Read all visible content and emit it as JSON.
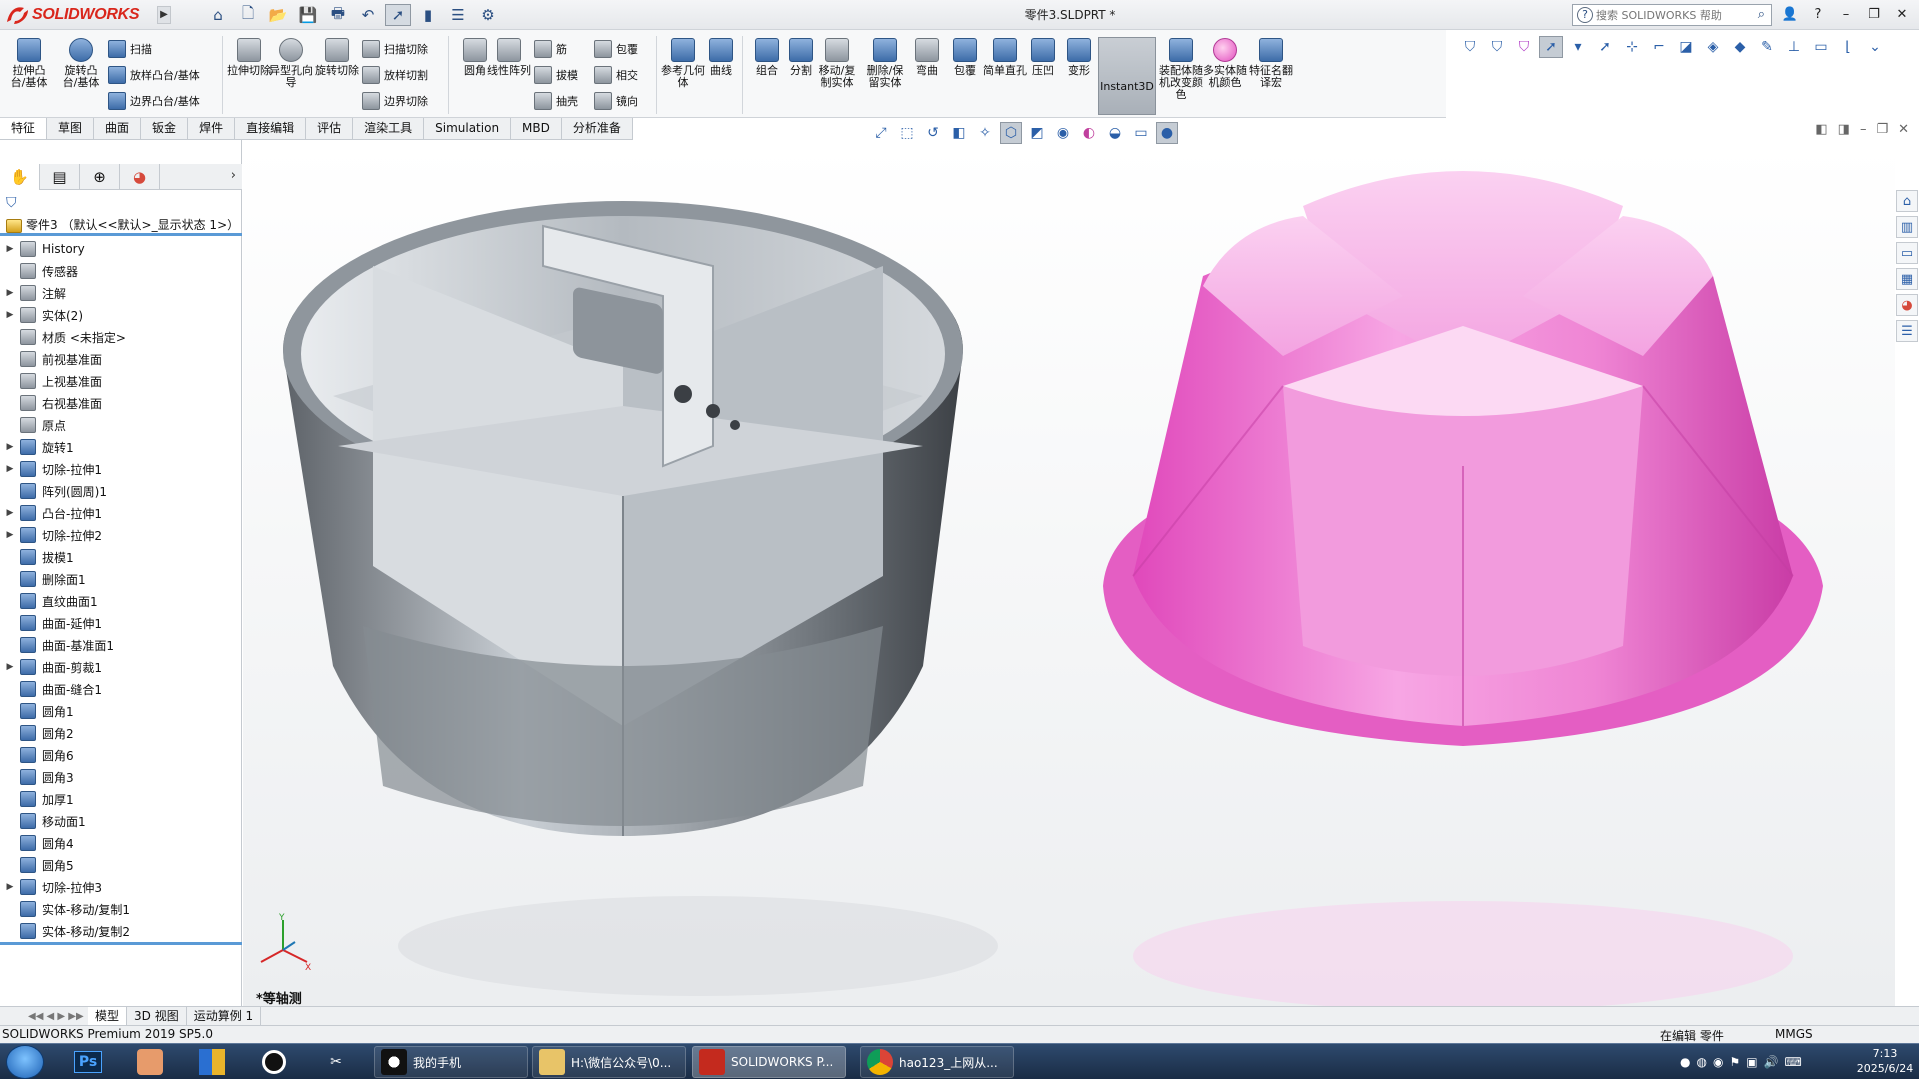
{
  "app": {
    "logo_brand": "SOLIDWORKS",
    "document_title": "零件3.SLDPRT *"
  },
  "search": {
    "placeholder": "搜索 SOLIDWORKS 帮助",
    "icon": "help-icon"
  },
  "quick_access": [
    "home-icon",
    "new-icon",
    "open-icon",
    "save-icon",
    "print-icon",
    "undo-icon",
    "select-icon",
    "traffic-light-icon",
    "options-icon",
    "settings-icon"
  ],
  "commands": {
    "extrude_boss": "拉伸凸台/基体",
    "revolve_boss": "旋转凸台/基体",
    "sweep": "扫描",
    "loft_boss": "放样凸台/基体",
    "boundary_boss": "边界凸台/基体",
    "extrude_cut": "拉伸切除",
    "hole_wizard": "异型孔向导",
    "revolve_cut": "旋转切除",
    "sweep_cut": "扫描切除",
    "loft_cut": "放样切割",
    "boundary_cut": "边界切除",
    "fillet": "圆角",
    "linear_pattern": "线性阵列",
    "rib": "筋",
    "draft": "拔模",
    "shell": "抽壳",
    "wrap": "包覆",
    "intersect": "相交",
    "mirror": "镜向",
    "ref_geometry": "参考几何体",
    "curves": "曲线",
    "combine": "组合",
    "split": "分割",
    "move_copy": "移动/复制实体",
    "delete_keep": "删除/保留实体",
    "flex": "弯曲",
    "wrap2": "包覆",
    "simple_hole": "简单直孔",
    "indent": "压凹",
    "deform": "变形",
    "instant3d": "Instant3D",
    "assembly_color": "装配体随机改变颜色",
    "multibody_color": "多实体随机颜色",
    "feature_translate": "特征名翻译宏"
  },
  "tabs": [
    "特征",
    "草图",
    "曲面",
    "钣金",
    "焊件",
    "直接编辑",
    "评估",
    "渲染工具",
    "Simulation",
    "MBD",
    "分析准备"
  ],
  "feature_tree": {
    "root": "零件3 （默认<<默认>_显示状态 1>）",
    "items": [
      {
        "label": "History",
        "expand": true
      },
      {
        "label": "传感器",
        "expand": false
      },
      {
        "label": "注解",
        "expand": true
      },
      {
        "label": "实体(2)",
        "expand": true
      },
      {
        "label": "材质 <未指定>",
        "expand": false
      },
      {
        "label": "前视基准面",
        "expand": false
      },
      {
        "label": "上视基准面",
        "expand": false
      },
      {
        "label": "右视基准面",
        "expand": false
      },
      {
        "label": "原点",
        "expand": false
      },
      {
        "label": "旋转1",
        "expand": true
      },
      {
        "label": "切除-拉伸1",
        "expand": true
      },
      {
        "label": "阵列(圆周)1",
        "expand": false
      },
      {
        "label": "凸台-拉伸1",
        "expand": true
      },
      {
        "label": "切除-拉伸2",
        "expand": true
      },
      {
        "label": "拔模1",
        "expand": false
      },
      {
        "label": "删除面1",
        "expand": false
      },
      {
        "label": "直纹曲面1",
        "expand": false
      },
      {
        "label": "曲面-延伸1",
        "expand": false
      },
      {
        "label": "曲面-基准面1",
        "expand": false
      },
      {
        "label": "曲面-剪裁1",
        "expand": true
      },
      {
        "label": "曲面-缝合1",
        "expand": false
      },
      {
        "label": "圆角1",
        "expand": false
      },
      {
        "label": "圆角2",
        "expand": false
      },
      {
        "label": "圆角6",
        "expand": false
      },
      {
        "label": "圆角3",
        "expand": false
      },
      {
        "label": "加厚1",
        "expand": false
      },
      {
        "label": "移动面1",
        "expand": false
      },
      {
        "label": "圆角4",
        "expand": false
      },
      {
        "label": "圆角5",
        "expand": false
      },
      {
        "label": "切除-拉伸3",
        "expand": true
      },
      {
        "label": "实体-移动/复制1",
        "expand": false
      },
      {
        "label": "实体-移动/复制2",
        "expand": false
      }
    ]
  },
  "viewport": {
    "view_name": "*等轴测",
    "part_colors": {
      "left": "#9aa3ab",
      "right": "#f48ad8"
    }
  },
  "bottom_tabs": [
    "模型",
    "3D 视图",
    "运动算例 1"
  ],
  "status": {
    "version": "SOLIDWORKS Premium 2019 SP5.0",
    "mode": "在编辑 零件",
    "units": "MMGS"
  },
  "taskbar": {
    "windows": [
      "我的手机",
      "H:\\微信公众号\\0...",
      "SOLIDWORKS P...",
      "hao123_上网从..."
    ],
    "time": "7:13",
    "date": "2025/6/24"
  }
}
